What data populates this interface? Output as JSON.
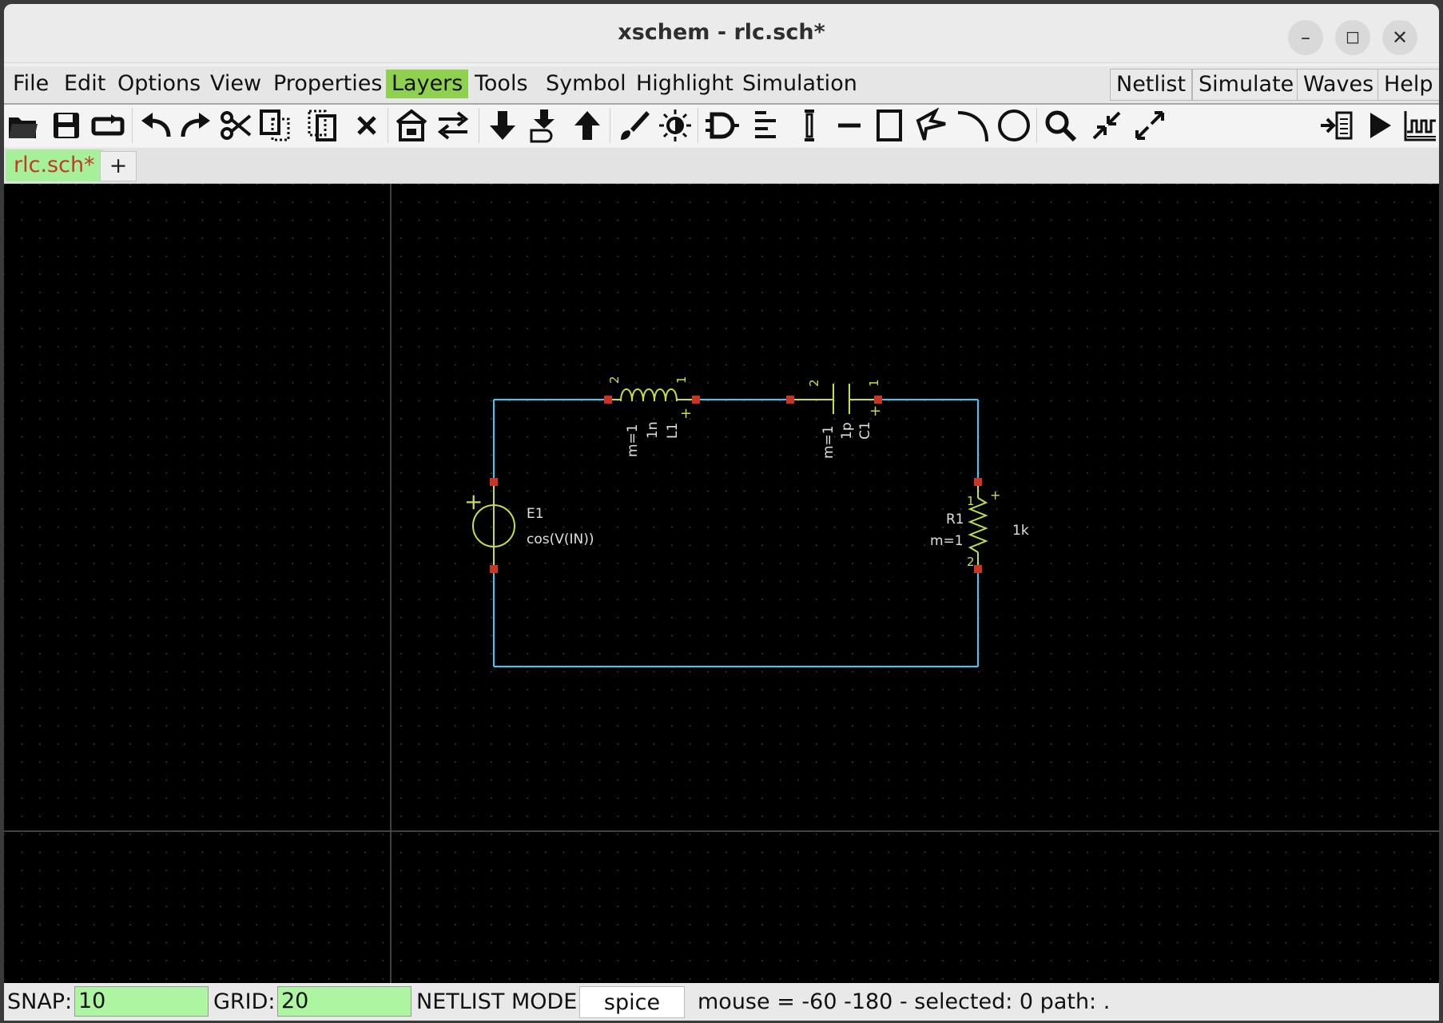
{
  "window": {
    "title": "xschem - rlc.sch*"
  },
  "window_controls": {
    "minimize": "–",
    "maximize": "◻",
    "close": "✕"
  },
  "menu": {
    "left": [
      "File",
      "Edit",
      "Options",
      "View",
      "Properties",
      "Layers",
      "Tools",
      "Symbol",
      "Highlight",
      "Simulation"
    ],
    "active": "Layers",
    "right": [
      "Netlist",
      "Simulate",
      "Waves",
      "Help"
    ]
  },
  "toolbar": {
    "icons": [
      "open-icon",
      "save-icon",
      "reload-icon",
      "undo-icon",
      "redo-icon",
      "cut-icon",
      "copy-icon",
      "move-icon",
      "delete-icon",
      "push-schematic-icon",
      "swap-icon",
      "descend-icon",
      "descend-symbol-icon",
      "ascend-icon",
      "brush-icon",
      "highlight-icon",
      "gate-icon",
      "text-align-icon",
      "pin-icon",
      "line-icon",
      "rect-icon",
      "polygon-icon",
      "arc-icon",
      "circle-icon",
      "zoom-icon",
      "zoom-in-icon",
      "zoom-out-icon",
      "netlist-run-icon",
      "simulate-icon",
      "waves-icon"
    ]
  },
  "tabs": {
    "items": [
      {
        "label": "rlc.sch*",
        "active": true
      }
    ],
    "add_label": "+"
  },
  "schematic": {
    "colors": {
      "wire": "#33ccff",
      "symbol": "#bfe04a",
      "pin": "#cc3322",
      "text": "#e0e0e0",
      "grid": "#555555"
    },
    "components": {
      "inductor": {
        "ref": "L1",
        "value": "1n",
        "mult": "m=1",
        "pin_left": "2",
        "pin_right": "1",
        "plus": "+"
      },
      "capacitor": {
        "ref": "C1",
        "value": "1p",
        "mult": "m=1",
        "pin_left": "2",
        "pin_right": "1",
        "plus": "+"
      },
      "source": {
        "ref": "E1",
        "expr": "cos(V(IN))",
        "plus": "+"
      },
      "resistor": {
        "ref": "R1",
        "value": "1k",
        "mult": "m=1",
        "pin_top": "1",
        "pin_bottom": "2",
        "plus": "+"
      }
    }
  },
  "status": {
    "snap_label": "SNAP:",
    "snap_value": "10",
    "grid_label": "GRID:",
    "grid_value": "20",
    "netlist_mode_label": "NETLIST MODE:",
    "netlist_mode_value": "spice",
    "info": "mouse = -60 -180 - selected: 0 path: ."
  }
}
